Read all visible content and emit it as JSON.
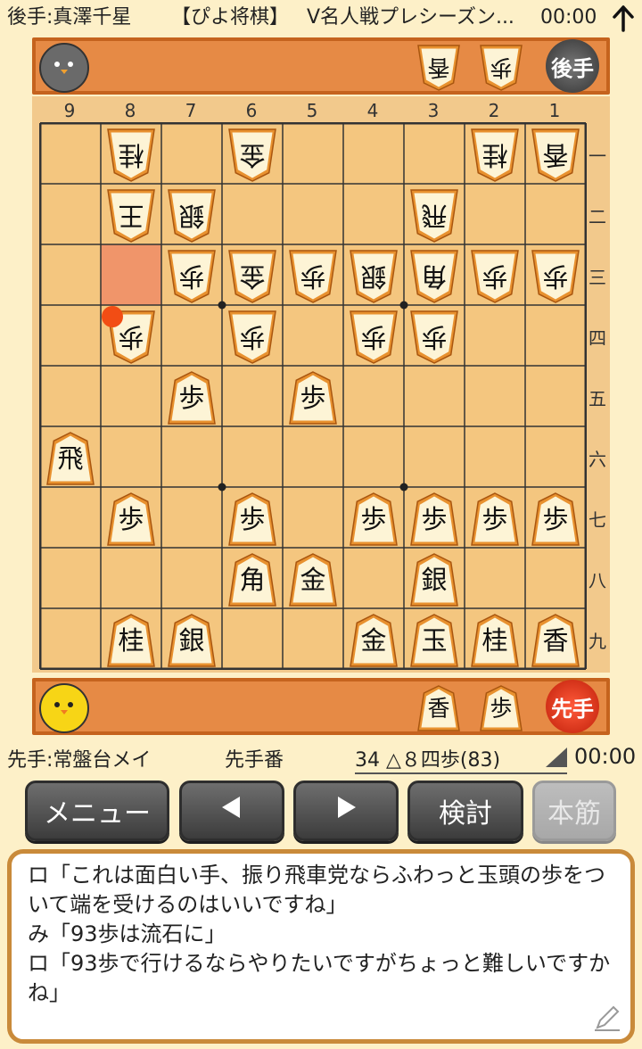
{
  "header": {
    "opponent": "後手:真澤千星",
    "site": "【ぴよ将棋】",
    "event": "V名人戦プレシーズン...",
    "opponent_time": "00:00",
    "collapse_icon": "arrow-up-icon"
  },
  "gote": {
    "avatar": "black-chick-avatar",
    "turn_label": "後手",
    "hand": [
      "香",
      "歩"
    ]
  },
  "sente": {
    "avatar": "yellow-chick-avatar",
    "turn_label": "先手",
    "hand": [
      "香",
      "歩"
    ],
    "player": "先手:常盤台メイ",
    "turn_status": "先手番",
    "move": "34 △８四歩(83)",
    "time": "00:00"
  },
  "board": {
    "files": [
      "9",
      "8",
      "7",
      "6",
      "5",
      "4",
      "3",
      "2",
      "1"
    ],
    "ranks": [
      "一",
      "二",
      "三",
      "四",
      "五",
      "六",
      "七",
      "八",
      "九"
    ],
    "pieces": [
      {
        "f": 8,
        "r": 1,
        "p": "桂",
        "g": true
      },
      {
        "f": 6,
        "r": 1,
        "p": "金",
        "g": true
      },
      {
        "f": 2,
        "r": 1,
        "p": "桂",
        "g": true
      },
      {
        "f": 1,
        "r": 1,
        "p": "香",
        "g": true
      },
      {
        "f": 8,
        "r": 2,
        "p": "王",
        "g": true
      },
      {
        "f": 7,
        "r": 2,
        "p": "銀",
        "g": true
      },
      {
        "f": 3,
        "r": 2,
        "p": "飛",
        "g": true
      },
      {
        "f": 7,
        "r": 3,
        "p": "歩",
        "g": true
      },
      {
        "f": 6,
        "r": 3,
        "p": "金",
        "g": true
      },
      {
        "f": 5,
        "r": 3,
        "p": "歩",
        "g": true
      },
      {
        "f": 4,
        "r": 3,
        "p": "銀",
        "g": true
      },
      {
        "f": 3,
        "r": 3,
        "p": "角",
        "g": true
      },
      {
        "f": 2,
        "r": 3,
        "p": "歩",
        "g": true
      },
      {
        "f": 1,
        "r": 3,
        "p": "歩",
        "g": true
      },
      {
        "f": 8,
        "r": 4,
        "p": "歩",
        "g": true
      },
      {
        "f": 6,
        "r": 4,
        "p": "歩",
        "g": true
      },
      {
        "f": 4,
        "r": 4,
        "p": "歩",
        "g": true
      },
      {
        "f": 3,
        "r": 4,
        "p": "歩",
        "g": true
      },
      {
        "f": 7,
        "r": 5,
        "p": "歩",
        "g": false
      },
      {
        "f": 5,
        "r": 5,
        "p": "歩",
        "g": false
      },
      {
        "f": 9,
        "r": 6,
        "p": "飛",
        "g": false
      },
      {
        "f": 8,
        "r": 7,
        "p": "歩",
        "g": false
      },
      {
        "f": 6,
        "r": 7,
        "p": "歩",
        "g": false
      },
      {
        "f": 4,
        "r": 7,
        "p": "歩",
        "g": false
      },
      {
        "f": 3,
        "r": 7,
        "p": "歩",
        "g": false
      },
      {
        "f": 2,
        "r": 7,
        "p": "歩",
        "g": false
      },
      {
        "f": 1,
        "r": 7,
        "p": "歩",
        "g": false
      },
      {
        "f": 6,
        "r": 8,
        "p": "角",
        "g": false
      },
      {
        "f": 5,
        "r": 8,
        "p": "金",
        "g": false
      },
      {
        "f": 3,
        "r": 8,
        "p": "銀",
        "g": false
      },
      {
        "f": 8,
        "r": 9,
        "p": "桂",
        "g": false
      },
      {
        "f": 7,
        "r": 9,
        "p": "銀",
        "g": false
      },
      {
        "f": 4,
        "r": 9,
        "p": "金",
        "g": false
      },
      {
        "f": 3,
        "r": 9,
        "p": "玉",
        "g": false
      },
      {
        "f": 2,
        "r": 9,
        "p": "桂",
        "g": false
      },
      {
        "f": 1,
        "r": 9,
        "p": "香",
        "g": false
      }
    ],
    "last_move_from": {
      "f": 8,
      "r": 3
    },
    "last_move_to": {
      "f": 8,
      "r": 4
    },
    "highlight_color": "#f0956a",
    "marker_color": "#f24d14"
  },
  "buttons": {
    "menu": "メニュー",
    "prev_icon": "triangle-left-icon",
    "next_icon": "triangle-right-icon",
    "analyze": "検討",
    "mainline": "本筋"
  },
  "comment": {
    "text": "ロ「これは面白い手、振り飛車党ならふわっと玉頭の歩をついて端を受けるのはいいですね」\nみ「93歩は流石に」\nロ「93歩で行けるならやりたいですがちょっと難しいですかね」",
    "edit_icon": "pencil-icon"
  }
}
